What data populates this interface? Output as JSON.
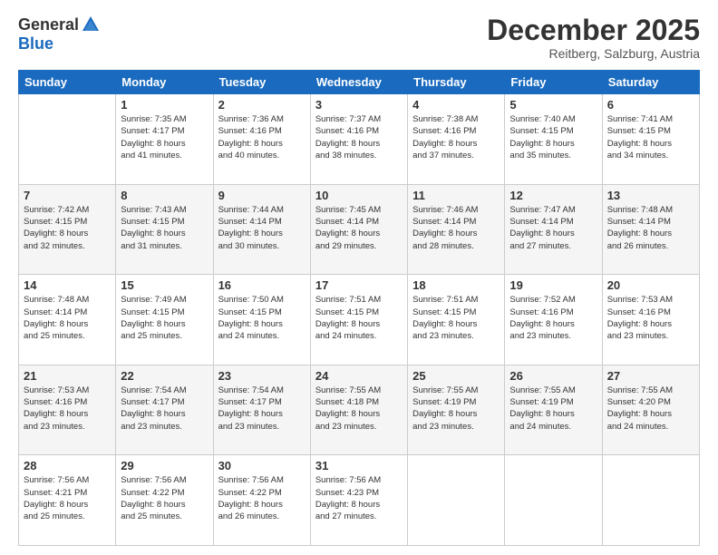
{
  "header": {
    "logo": {
      "line1": "General",
      "line2": "Blue"
    },
    "title": "December 2025",
    "subtitle": "Reitberg, Salzburg, Austria"
  },
  "days_of_week": [
    "Sunday",
    "Monday",
    "Tuesday",
    "Wednesday",
    "Thursday",
    "Friday",
    "Saturday"
  ],
  "weeks": [
    [
      {
        "day": "",
        "info": ""
      },
      {
        "day": "1",
        "info": "Sunrise: 7:35 AM\nSunset: 4:17 PM\nDaylight: 8 hours\nand 41 minutes."
      },
      {
        "day": "2",
        "info": "Sunrise: 7:36 AM\nSunset: 4:16 PM\nDaylight: 8 hours\nand 40 minutes."
      },
      {
        "day": "3",
        "info": "Sunrise: 7:37 AM\nSunset: 4:16 PM\nDaylight: 8 hours\nand 38 minutes."
      },
      {
        "day": "4",
        "info": "Sunrise: 7:38 AM\nSunset: 4:16 PM\nDaylight: 8 hours\nand 37 minutes."
      },
      {
        "day": "5",
        "info": "Sunrise: 7:40 AM\nSunset: 4:15 PM\nDaylight: 8 hours\nand 35 minutes."
      },
      {
        "day": "6",
        "info": "Sunrise: 7:41 AM\nSunset: 4:15 PM\nDaylight: 8 hours\nand 34 minutes."
      }
    ],
    [
      {
        "day": "7",
        "info": "Sunrise: 7:42 AM\nSunset: 4:15 PM\nDaylight: 8 hours\nand 32 minutes."
      },
      {
        "day": "8",
        "info": "Sunrise: 7:43 AM\nSunset: 4:15 PM\nDaylight: 8 hours\nand 31 minutes."
      },
      {
        "day": "9",
        "info": "Sunrise: 7:44 AM\nSunset: 4:14 PM\nDaylight: 8 hours\nand 30 minutes."
      },
      {
        "day": "10",
        "info": "Sunrise: 7:45 AM\nSunset: 4:14 PM\nDaylight: 8 hours\nand 29 minutes."
      },
      {
        "day": "11",
        "info": "Sunrise: 7:46 AM\nSunset: 4:14 PM\nDaylight: 8 hours\nand 28 minutes."
      },
      {
        "day": "12",
        "info": "Sunrise: 7:47 AM\nSunset: 4:14 PM\nDaylight: 8 hours\nand 27 minutes."
      },
      {
        "day": "13",
        "info": "Sunrise: 7:48 AM\nSunset: 4:14 PM\nDaylight: 8 hours\nand 26 minutes."
      }
    ],
    [
      {
        "day": "14",
        "info": "Sunrise: 7:48 AM\nSunset: 4:14 PM\nDaylight: 8 hours\nand 25 minutes."
      },
      {
        "day": "15",
        "info": "Sunrise: 7:49 AM\nSunset: 4:15 PM\nDaylight: 8 hours\nand 25 minutes."
      },
      {
        "day": "16",
        "info": "Sunrise: 7:50 AM\nSunset: 4:15 PM\nDaylight: 8 hours\nand 24 minutes."
      },
      {
        "day": "17",
        "info": "Sunrise: 7:51 AM\nSunset: 4:15 PM\nDaylight: 8 hours\nand 24 minutes."
      },
      {
        "day": "18",
        "info": "Sunrise: 7:51 AM\nSunset: 4:15 PM\nDaylight: 8 hours\nand 23 minutes."
      },
      {
        "day": "19",
        "info": "Sunrise: 7:52 AM\nSunset: 4:16 PM\nDaylight: 8 hours\nand 23 minutes."
      },
      {
        "day": "20",
        "info": "Sunrise: 7:53 AM\nSunset: 4:16 PM\nDaylight: 8 hours\nand 23 minutes."
      }
    ],
    [
      {
        "day": "21",
        "info": "Sunrise: 7:53 AM\nSunset: 4:16 PM\nDaylight: 8 hours\nand 23 minutes."
      },
      {
        "day": "22",
        "info": "Sunrise: 7:54 AM\nSunset: 4:17 PM\nDaylight: 8 hours\nand 23 minutes."
      },
      {
        "day": "23",
        "info": "Sunrise: 7:54 AM\nSunset: 4:17 PM\nDaylight: 8 hours\nand 23 minutes."
      },
      {
        "day": "24",
        "info": "Sunrise: 7:55 AM\nSunset: 4:18 PM\nDaylight: 8 hours\nand 23 minutes."
      },
      {
        "day": "25",
        "info": "Sunrise: 7:55 AM\nSunset: 4:19 PM\nDaylight: 8 hours\nand 23 minutes."
      },
      {
        "day": "26",
        "info": "Sunrise: 7:55 AM\nSunset: 4:19 PM\nDaylight: 8 hours\nand 24 minutes."
      },
      {
        "day": "27",
        "info": "Sunrise: 7:55 AM\nSunset: 4:20 PM\nDaylight: 8 hours\nand 24 minutes."
      }
    ],
    [
      {
        "day": "28",
        "info": "Sunrise: 7:56 AM\nSunset: 4:21 PM\nDaylight: 8 hours\nand 25 minutes."
      },
      {
        "day": "29",
        "info": "Sunrise: 7:56 AM\nSunset: 4:22 PM\nDaylight: 8 hours\nand 25 minutes."
      },
      {
        "day": "30",
        "info": "Sunrise: 7:56 AM\nSunset: 4:22 PM\nDaylight: 8 hours\nand 26 minutes."
      },
      {
        "day": "31",
        "info": "Sunrise: 7:56 AM\nSunset: 4:23 PM\nDaylight: 8 hours\nand 27 minutes."
      },
      {
        "day": "",
        "info": ""
      },
      {
        "day": "",
        "info": ""
      },
      {
        "day": "",
        "info": ""
      }
    ]
  ]
}
